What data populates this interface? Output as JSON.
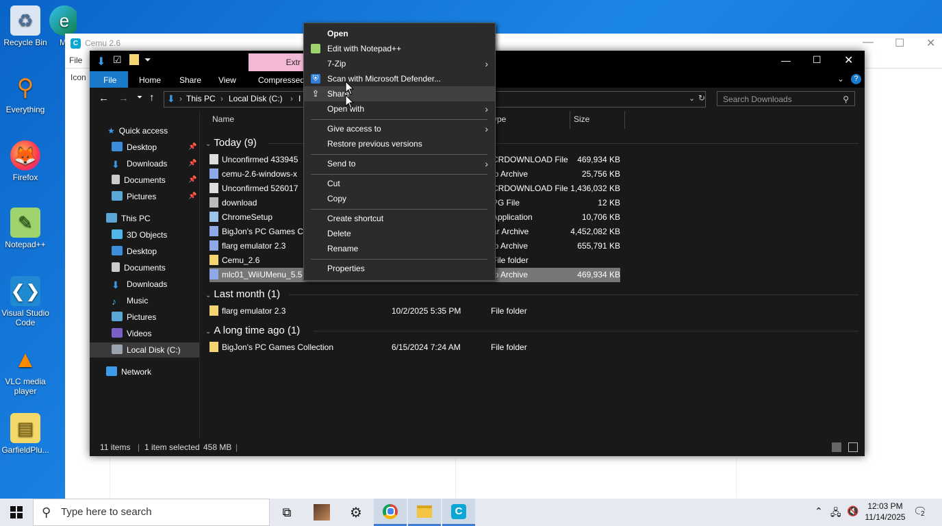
{
  "desktop": {
    "icons": [
      {
        "label": "Recycle Bin",
        "icon": "recycle-bin-icon"
      },
      {
        "label": "Everything",
        "icon": "search-magnifier-icon"
      },
      {
        "label": "Firefox",
        "icon": "firefox-icon"
      },
      {
        "label": "Notepad++",
        "icon": "notepad-plus-icon"
      },
      {
        "label": "Visual Studio Code",
        "icon": "vscode-icon"
      },
      {
        "label": "VLC media player",
        "icon": "vlc-cone-icon"
      },
      {
        "label": "GarfieldPlu...",
        "icon": "zip-folder-icon"
      }
    ],
    "partial_icon_letter": "M"
  },
  "cemu_window": {
    "title": "Cemu 2.6",
    "menu_file": "File",
    "icon_column": "Icon"
  },
  "explorer": {
    "ribbon_context_tab": "Extr",
    "tabs": {
      "file": "File",
      "home": "Home",
      "share": "Share",
      "view": "View",
      "compressed": "Compressed"
    },
    "address": {
      "this_pc": "This PC",
      "local_disk": "Local Disk (C:)",
      "partial": "I"
    },
    "search_placeholder": "Search Downloads",
    "nav": {
      "quick_access": "Quick access",
      "desktop": "Desktop",
      "downloads": "Downloads",
      "documents": "Documents",
      "pictures": "Pictures",
      "this_pc": "This PC",
      "objects3d": "3D Objects",
      "desktop2": "Desktop",
      "documents2": "Documents",
      "downloads2": "Downloads",
      "music": "Music",
      "pictures2": "Pictures",
      "videos": "Videos",
      "local_disk": "Local Disk (C:)",
      "network": "Network"
    },
    "columns": {
      "name": "Name",
      "type": "ype",
      "size": "Size"
    },
    "groups": {
      "today": "Today (9)",
      "last_month": "Last month (1)",
      "long_ago": "A long time ago (1)"
    },
    "today_rows": [
      {
        "name": "Unconfirmed 433945",
        "type": "CRDOWNLOAD File",
        "size": "469,934 KB"
      },
      {
        "name": "cemu-2.6-windows-x",
        "type": "ip Archive",
        "size": "25,756 KB"
      },
      {
        "name": "Unconfirmed 526017",
        "type": "CRDOWNLOAD File",
        "size": "1,436,032 KB"
      },
      {
        "name": "download",
        "type": "PG File",
        "size": "12 KB"
      },
      {
        "name": "ChromeSetup",
        "type": "Application",
        "size": "10,706 KB"
      },
      {
        "name": "BigJon's PC Games C",
        "type": "ar Archive",
        "size": "4,452,082 KB"
      },
      {
        "name": "flarg emulator 2.3",
        "type": "ip Archive",
        "size": "655,791 KB"
      },
      {
        "name": "Cemu_2.6",
        "type": "File folder",
        "size": ""
      },
      {
        "name": "mlc01_WiiUMenu_5.5",
        "type": "ip Archive",
        "size": "469,934 KB"
      }
    ],
    "last_month_row": {
      "name": "flarg emulator 2.3",
      "date": "10/2/2025 5:35 PM",
      "type": "File folder"
    },
    "long_ago_row": {
      "name": "BigJon's PC Games Collection",
      "date": "6/15/2024 7:24 AM",
      "type": "File folder"
    },
    "status": {
      "items": "11 items",
      "selected": "1 item selected",
      "size": "458 MB"
    }
  },
  "context_menu": {
    "open": "Open",
    "notepad": "Edit with Notepad++",
    "sevenzip": "7-Zip",
    "defender": "Scan with Microsoft Defender...",
    "share": "Share",
    "open_with": "Open with",
    "give_access": "Give access to",
    "restore": "Restore previous versions",
    "send_to": "Send to",
    "cut": "Cut",
    "copy": "Copy",
    "create_shortcut": "Create shortcut",
    "delete": "Delete",
    "rename": "Rename",
    "properties": "Properties"
  },
  "taskbar": {
    "search_placeholder": "Type here to search",
    "time": "12:03 PM",
    "date": "11/14/2025",
    "notification_count": "2"
  },
  "colors": {
    "accent": "#0078d7",
    "explorer_bg": "#191919",
    "menu_bg": "#2b2b2b",
    "selection": "#777777"
  }
}
